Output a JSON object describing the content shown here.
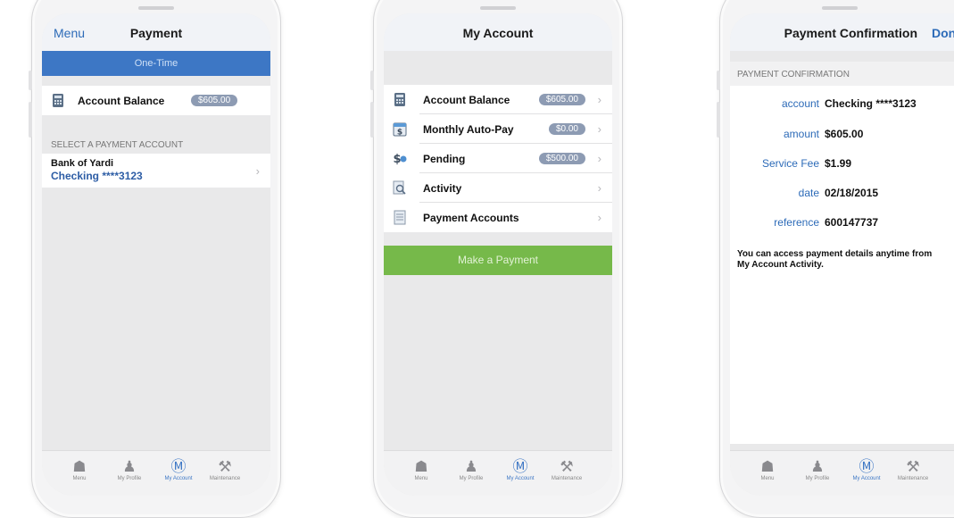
{
  "phone1": {
    "nav": {
      "left": "Menu",
      "title": "Payment"
    },
    "segment": "One-Time",
    "balance": {
      "label": "Account Balance",
      "value": "$605.00"
    },
    "section_header": "SELECT A PAYMENT ACCOUNT",
    "account": {
      "bank": "Bank of Yardi",
      "number": "Checking ****3123"
    }
  },
  "phone2": {
    "nav": {
      "title": "My Account"
    },
    "items": [
      {
        "label": "Account Balance",
        "value": "$605.00",
        "icon": "calculator-icon"
      },
      {
        "label": "Monthly Auto-Pay",
        "value": "$0.00",
        "icon": "calendar-dollar-icon"
      },
      {
        "label": "Pending",
        "value": "$500.00",
        "icon": "pending-dollar-icon"
      },
      {
        "label": "Activity",
        "value": "",
        "icon": "magnifier-icon"
      },
      {
        "label": "Payment Accounts",
        "value": "",
        "icon": "document-icon"
      }
    ],
    "action": "Make a Payment"
  },
  "phone3": {
    "nav": {
      "title": "Payment Confirmation",
      "right": "Done"
    },
    "section_header": "PAYMENT CONFIRMATION",
    "fields": [
      {
        "key": "account",
        "value": "Checking ****3123"
      },
      {
        "key": "amount",
        "value": "$605.00"
      },
      {
        "key": "Service Fee",
        "value": "$1.99"
      },
      {
        "key": "date",
        "value": "02/18/2015"
      },
      {
        "key": "reference",
        "value": "600147737"
      }
    ],
    "note": "You can access payment details anytime from My Account Activity."
  },
  "tabbar": {
    "items": [
      {
        "label": "Menu",
        "icon": "home-icon"
      },
      {
        "label": "My Profile",
        "icon": "person-icon"
      },
      {
        "label": "My Account",
        "icon": "dollar-circle-icon"
      },
      {
        "label": "Maintenance",
        "icon": "tools-icon"
      }
    ],
    "active": "My Account"
  },
  "colors": {
    "accent": "#3d77c5",
    "link": "#2d6bb8",
    "pill": "#8d9bb3",
    "action": "#76b94a"
  }
}
